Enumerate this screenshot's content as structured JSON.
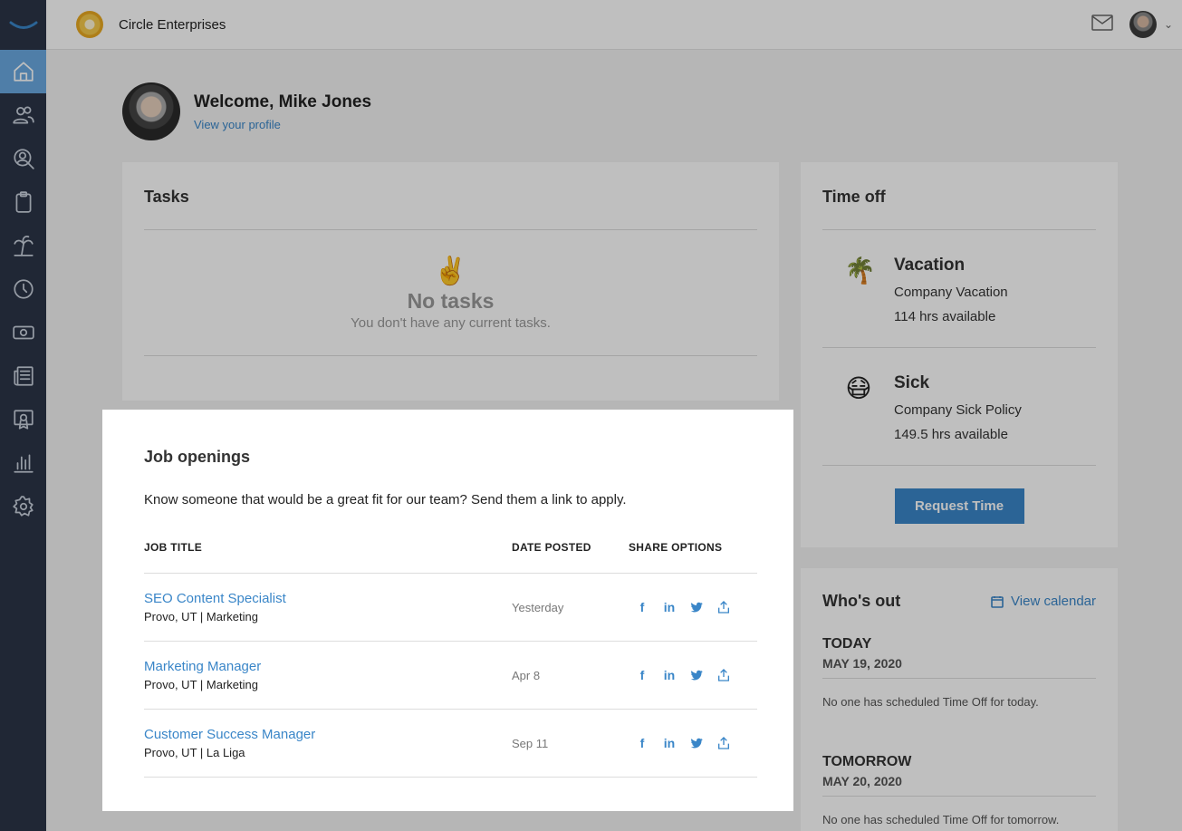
{
  "header": {
    "company_name": "Circle Enterprises"
  },
  "sidebar": {
    "items": [
      {
        "icon": "home-icon"
      },
      {
        "icon": "people-icon"
      },
      {
        "icon": "user-search-icon"
      },
      {
        "icon": "clipboard-icon"
      },
      {
        "icon": "palm-tree-icon"
      },
      {
        "icon": "clock-icon"
      },
      {
        "icon": "money-icon"
      },
      {
        "icon": "news-icon"
      },
      {
        "icon": "certificate-icon"
      },
      {
        "icon": "bar-chart-icon"
      },
      {
        "icon": "gear-icon"
      }
    ]
  },
  "welcome": {
    "title": "Welcome, Mike Jones",
    "profile_link": "View your profile"
  },
  "tasks": {
    "title": "Tasks",
    "emoji": "✌️",
    "empty_title": "No tasks",
    "empty_sub": "You don't have any current tasks."
  },
  "time_off": {
    "title": "Time off",
    "items": [
      {
        "emoji": "🌴",
        "name": "Vacation",
        "policy": "Company Vacation",
        "available": "114 hrs available"
      },
      {
        "emoji": "😷",
        "name": "Sick",
        "policy": "Company Sick Policy",
        "available": "149.5 hrs available"
      }
    ],
    "request_button": "Request Time"
  },
  "whos_out": {
    "title": "Who's out",
    "view_calendar": "View calendar",
    "days": [
      {
        "label": "TODAY",
        "date": "MAY 19, 2020",
        "message": "No one has scheduled Time Off for today."
      },
      {
        "label": "TOMORROW",
        "date": "MAY 20, 2020",
        "message": "No one has scheduled Time Off for tomorrow."
      }
    ]
  },
  "jobs": {
    "title": "Job openings",
    "description": "Know someone that would be a great fit for our team? Send them a link to apply.",
    "columns": {
      "title": "JOB TITLE",
      "date": "DATE POSTED",
      "share": "SHARE OPTIONS"
    },
    "rows": [
      {
        "title": "SEO Content Specialist",
        "meta": "Provo, UT | Marketing",
        "date": "Yesterday"
      },
      {
        "title": "Marketing Manager",
        "meta": "Provo, UT | Marketing",
        "date": "Apr 8"
      },
      {
        "title": "Customer Success Manager",
        "meta": "Provo, UT | La Liga",
        "date": "Sep 11"
      }
    ],
    "share_labels": {
      "facebook": "f",
      "linkedin": "in"
    }
  },
  "colors": {
    "accent": "#3a86c8",
    "sidebar": "#2b3447",
    "sidebar_active": "#6aa9e0"
  }
}
